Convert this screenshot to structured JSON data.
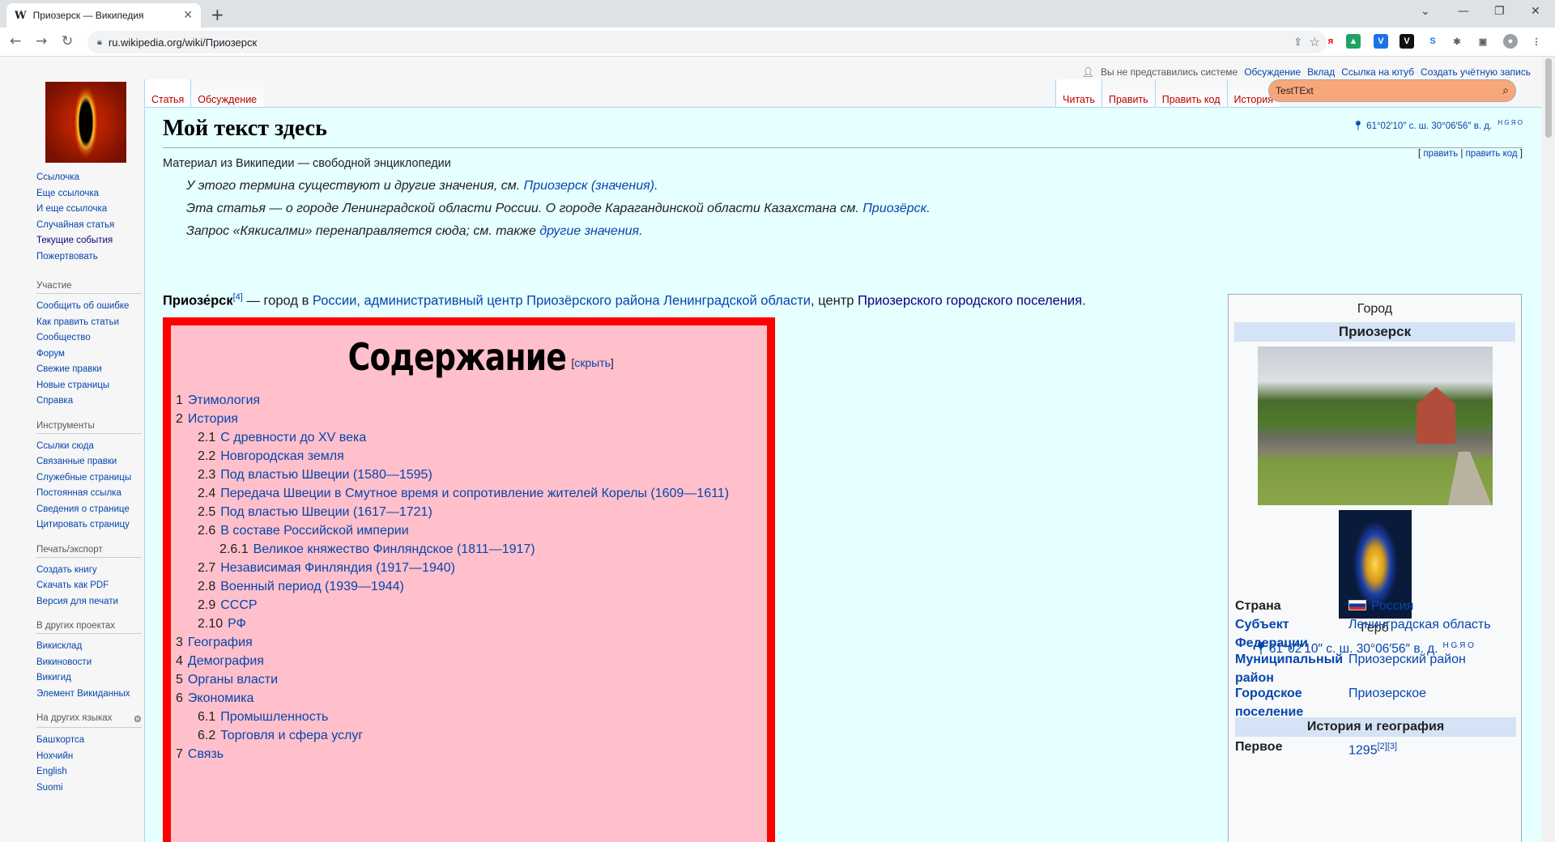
{
  "browser": {
    "tab_title": "Приозерск — Википедия",
    "tab_favicon": "W",
    "url": "ru.wikipedia.org/wiki/Приозерск"
  },
  "usermenu": {
    "not_logged": "Вы не представились системе",
    "links": [
      "Обсуждение",
      "Вклад",
      "Ссылка на ютуб",
      "Создать учётную запись"
    ]
  },
  "sidebar": {
    "main_links": [
      "Ссылочка",
      "Еще ссылочка",
      "И еще ссылочка",
      "Случайная статья",
      "Текущие события",
      "Пожертвовать"
    ],
    "sections": [
      {
        "title": "Участие",
        "links": [
          "Сообщить об ошибке",
          "Как править статьи",
          "Сообщество",
          "Форум",
          "Свежие правки",
          "Новые страницы",
          "Справка"
        ]
      },
      {
        "title": "Инструменты",
        "links": [
          "Ссылки сюда",
          "Связанные правки",
          "Служебные страницы",
          "Постоянная ссылка",
          "Сведения о странице",
          "Цитировать страницу"
        ]
      },
      {
        "title": "Печать/экспорт",
        "links": [
          "Создать книгу",
          "Скачать как PDF",
          "Версия для печати"
        ]
      },
      {
        "title": "В других проектах",
        "links": [
          "Викисклад",
          "Викиновости",
          "Викигид",
          "Элемент Викиданных"
        ]
      },
      {
        "title": "На других языках",
        "links": [
          "Башҡортса",
          "Нохчийн",
          "English",
          "Suomi"
        ]
      }
    ]
  },
  "tabs": {
    "left": [
      "Статья",
      "Обсуждение"
    ],
    "right": [
      "Читать",
      "Править",
      "Править код",
      "История"
    ]
  },
  "search": {
    "value": "TestTExt"
  },
  "article": {
    "title": "Мой текст здесь",
    "subtitle": "Материал из Википедии — свободной энциклопедии",
    "coord": "61°02′10″ с. ш. 30°06′56″ в. д.",
    "coord_links": "H G Я O",
    "edit": "править",
    "edit_code": "править код",
    "hatnotes": [
      {
        "text": "У этого термина существуют и другие значения, см. ",
        "link": "Приозерск (значения)",
        "tail": "."
      },
      {
        "text": "Эта статья — о городе Ленинградской области России. О городе Карагандинской области Казахстана см. ",
        "link": "Приозёрск",
        "tail": "."
      },
      {
        "text": "Запрос «Кякисалми» перенаправляется сюда; см. также ",
        "link": "другие значения",
        "tail": "."
      }
    ],
    "lead": {
      "bold": "Приозе́рск",
      "ref": "[4]",
      "part1": " — город в ",
      "link1": "России, административный центр Приозёрского района Ленинградской области",
      "part2": ", центр ",
      "link2": "Приозерского городского поселения",
      "part3": "."
    }
  },
  "toc": {
    "title": "Содержание",
    "hide": "скрыть",
    "items": [
      {
        "n": "1",
        "t": "Этимология",
        "lvl": 1
      },
      {
        "n": "2",
        "t": "История",
        "lvl": 1
      },
      {
        "n": "2.1",
        "t": "С древности до XV века",
        "lvl": 2
      },
      {
        "n": "2.2",
        "t": "Новгородская земля",
        "lvl": 2
      },
      {
        "n": "2.3",
        "t": "Под властью Швеции (1580—1595)",
        "lvl": 2
      },
      {
        "n": "2.4",
        "t": "Передача Швеции в Смутное время и сопротивление жителей Корелы (1609—1611)",
        "lvl": 2
      },
      {
        "n": "2.5",
        "t": "Под властью Швеции (1617—1721)",
        "lvl": 2
      },
      {
        "n": "2.6",
        "t": "В составе Российской империи",
        "lvl": 2
      },
      {
        "n": "2.6.1",
        "t": "Великое княжество Финляндское (1811—1917)",
        "lvl": 3
      },
      {
        "n": "2.7",
        "t": "Независимая Финляндия (1917—1940)",
        "lvl": 2
      },
      {
        "n": "2.8",
        "t": "Военный период (1939—1944)",
        "lvl": 2
      },
      {
        "n": "2.9",
        "t": "СССР",
        "lvl": 2
      },
      {
        "n": "2.10",
        "t": "РФ",
        "lvl": 2
      },
      {
        "n": "3",
        "t": "География",
        "lvl": 1
      },
      {
        "n": "4",
        "t": "Демография",
        "lvl": 1
      },
      {
        "n": "5",
        "t": "Органы власти",
        "lvl": 1
      },
      {
        "n": "6",
        "t": "Экономика",
        "lvl": 1
      },
      {
        "n": "6.1",
        "t": "Промышленность",
        "lvl": 2
      },
      {
        "n": "6.2",
        "t": "Торговля и сфера услуг",
        "lvl": 2
      },
      {
        "n": "7",
        "t": "Связь",
        "lvl": 1
      }
    ]
  },
  "infobox": {
    "type": "Город",
    "name": "Приозерск",
    "emblem_caption": "Герб",
    "coord": "61°02′10″ с. ш. 30°06′56″ в. д.",
    "coord_links": "H G Я O",
    "rows": [
      {
        "k1": "Страна",
        "k2": "",
        "v1": "Россия",
        "v2": "",
        "flag": true,
        "klink": false
      },
      {
        "k1": "Субъект",
        "k2": "Федерации",
        "v1": "Ленинградская область",
        "v2": "",
        "flag": false,
        "klink": true
      },
      {
        "k1": "Муниципальный",
        "k2": "район",
        "v1": "Приозерский район",
        "v2": "",
        "flag": false,
        "klink": true
      },
      {
        "k1": "Городское",
        "k2": "поселение",
        "v1": "Приозерское",
        "v2": "",
        "flag": false,
        "klink": true
      }
    ],
    "section": "История и география",
    "first_label": "Первое",
    "first_value": "1295",
    "first_refs": "[2][3]"
  }
}
